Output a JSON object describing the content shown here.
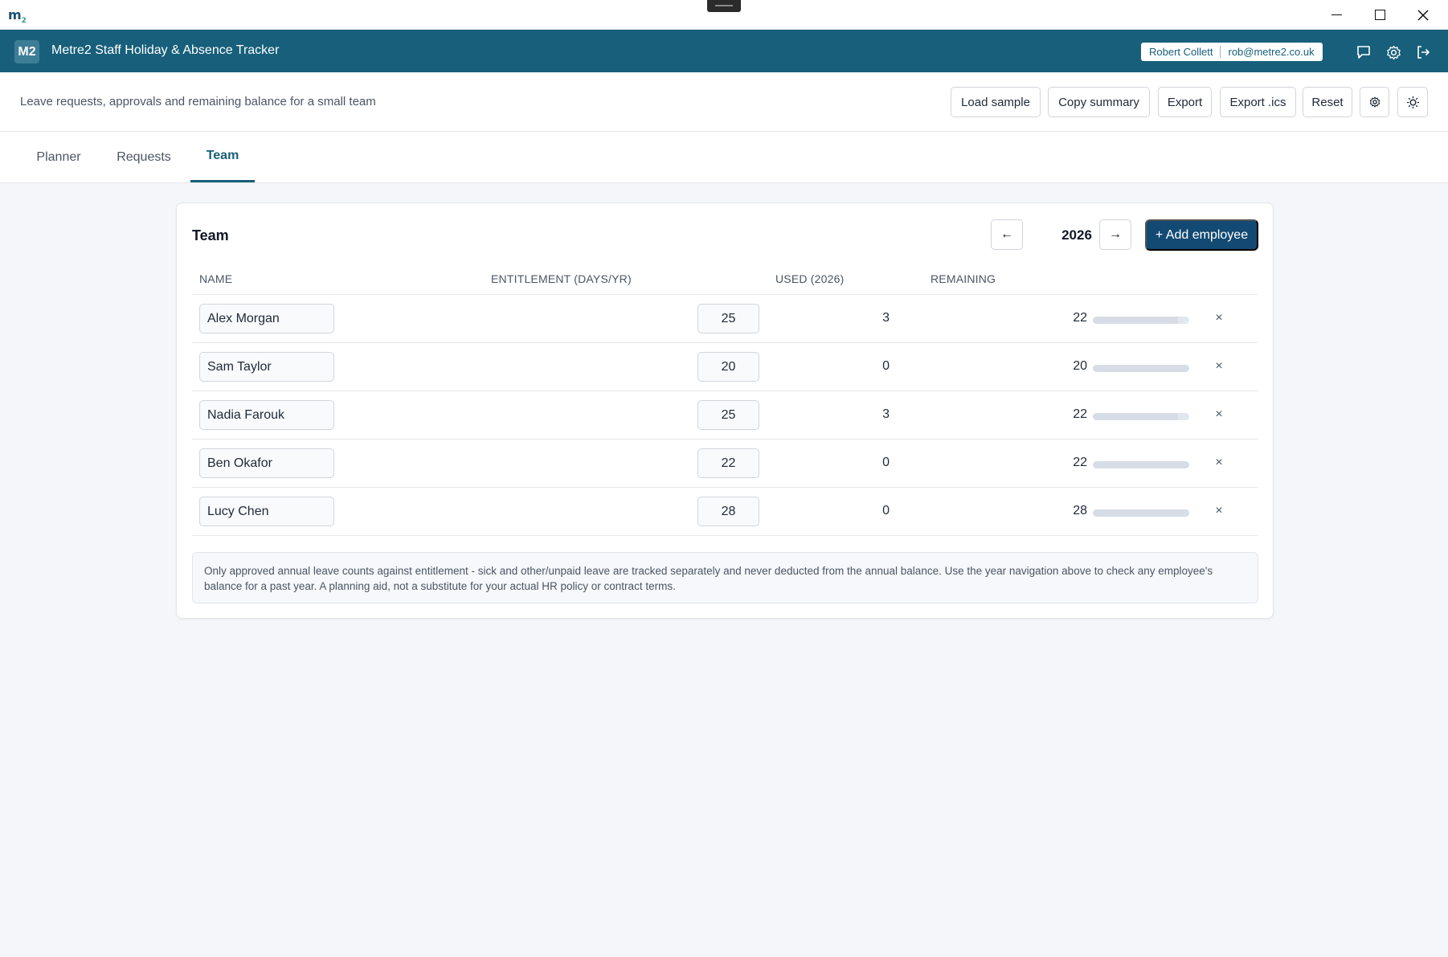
{
  "window": {
    "logo_text": "m",
    "logo_sub": "2"
  },
  "header": {
    "badge": "M2",
    "title": "Metre2 Staff Holiday & Absence Tracker",
    "user_name": "Robert Collett",
    "user_email": "rob@metre2.co.uk",
    "icons": [
      "chat-icon",
      "gear-icon",
      "logout-icon"
    ]
  },
  "toolbar": {
    "subtitle": "Leave requests, approvals and remaining balance for a small team",
    "buttons": {
      "load_sample": "Load sample",
      "copy_summary": "Copy summary",
      "export": "Export",
      "export_ics": "Export .ics",
      "reset": "Reset"
    },
    "icons": [
      "settings-icon",
      "theme-icon"
    ]
  },
  "tabs": [
    {
      "label": "Planner",
      "active": false
    },
    {
      "label": "Requests",
      "active": false
    },
    {
      "label": "Team",
      "active": true
    }
  ],
  "team": {
    "title": "Team",
    "year": "2026",
    "prev_label": "←",
    "next_label": "→",
    "add_label": "+ Add employee",
    "columns": [
      "NAME",
      "ENTITLEMENT (DAYS/YR)",
      "USED (2026)",
      "REMAINING"
    ],
    "rows": [
      {
        "name": "Alex Morgan",
        "entitlement": "25",
        "used": "3",
        "remaining": "22",
        "remaining_fraction": 0.88
      },
      {
        "name": "Sam Taylor",
        "entitlement": "20",
        "used": "0",
        "remaining": "20",
        "remaining_fraction": 1.0
      },
      {
        "name": "Nadia Farouk",
        "entitlement": "25",
        "used": "3",
        "remaining": "22",
        "remaining_fraction": 0.88
      },
      {
        "name": "Ben Okafor",
        "entitlement": "22",
        "used": "0",
        "remaining": "22",
        "remaining_fraction": 1.0
      },
      {
        "name": "Lucy Chen",
        "entitlement": "28",
        "used": "0",
        "remaining": "28",
        "remaining_fraction": 1.0
      }
    ],
    "delete_label": "×",
    "note": "Only approved annual leave counts against entitlement - sick and other/unpaid leave are tracked separately and never deducted from the annual balance. Use the year navigation above to check any employee's balance for a past year. A planning aid, not a substitute for your actual HR policy or contract terms."
  },
  "colors": {
    "header_bg": "#175f7a",
    "primary_button": "#134a73",
    "page_bg": "#f4f6fa"
  }
}
